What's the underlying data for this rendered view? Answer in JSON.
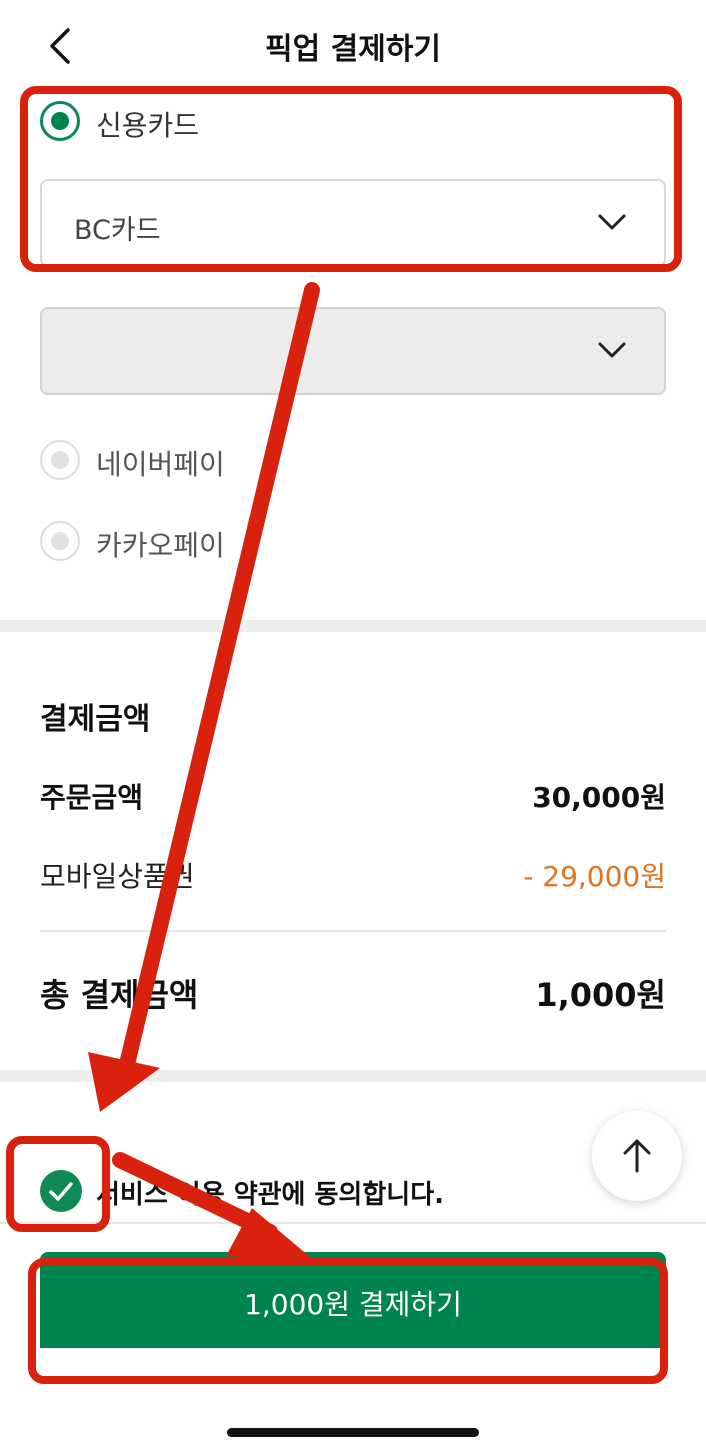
{
  "header": {
    "title": "픽업 결제하기"
  },
  "payment_methods": {
    "credit_card": {
      "label": "신용카드",
      "selected": true
    },
    "card_select": {
      "value": "BC카드"
    },
    "installment_select": {
      "value": ""
    },
    "naver_pay": {
      "label": "네이버페이",
      "selected": false
    },
    "kakao_pay": {
      "label": "카카오페이",
      "selected": false
    }
  },
  "amount": {
    "title": "결제금액",
    "order_label": "주문금액",
    "order_value": "30,000원",
    "voucher_label": "모바일상품권",
    "voucher_value": "- 29,000원",
    "total_label": "총 결제금액",
    "total_value": "1,000원"
  },
  "agreement": {
    "text": "서비스 이용 약관에 동의합니다.",
    "checked": true
  },
  "pay_button": {
    "label": "1,000원 결제하기"
  },
  "colors": {
    "brand_green": "#00844f",
    "discount_orange": "#e0741f",
    "annotation_red": "#d8220d"
  }
}
